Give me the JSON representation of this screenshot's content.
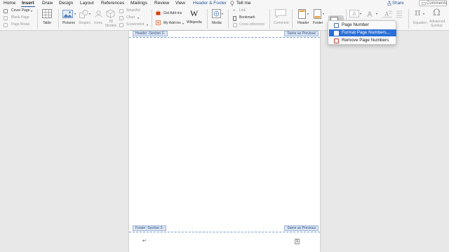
{
  "menubar": {
    "tabs": [
      "Home",
      "Insert",
      "Draw",
      "Design",
      "Layout",
      "References",
      "Mailings",
      "Review",
      "View",
      "Header & Footer"
    ],
    "tell_me": "Tell me",
    "share": "Share",
    "comments": "Comments"
  },
  "ribbon": {
    "pages": {
      "cover_page": "Cover Page",
      "blank_page": "Blank Page",
      "page_break": "Page Break"
    },
    "table": "Table",
    "pictures": "Pictures",
    "shapes": "Shapes",
    "icons": "Icons",
    "models_3d_line1": "3D",
    "models_3d_line2": "Models",
    "smartart": "SmartArt",
    "chart": "Chart",
    "screenshot": "Screenshot",
    "get_addins": "Get Add-ins",
    "my_addins": "My Add-ins",
    "wikipedia": "Wikipedia",
    "media": "Media",
    "link": "Link",
    "bookmark": "Bookmark",
    "cross_reference": "Cross-reference",
    "comment": "Comment",
    "header": "Header",
    "footer": "Footer",
    "equation": "Equation",
    "advanced_symbol_line1": "Advanced",
    "advanced_symbol_line2": "Symbol"
  },
  "document": {
    "header_label": "Header -Section 2-",
    "header_same": "Same as Previous",
    "footer_label": "Footer -Section 2-",
    "footer_same": "Same as Previous",
    "page_number_field": "1",
    "paragraph_mark": "↵"
  },
  "dropdown": {
    "items": [
      "Page Number",
      "Format Page Numbers...",
      "Remove Page Numbers"
    ],
    "selected_index": 1
  },
  "colors": {
    "accent": "#2b579a",
    "selection": "#2c6fd6",
    "hf_tab": "#dbe5f3"
  }
}
